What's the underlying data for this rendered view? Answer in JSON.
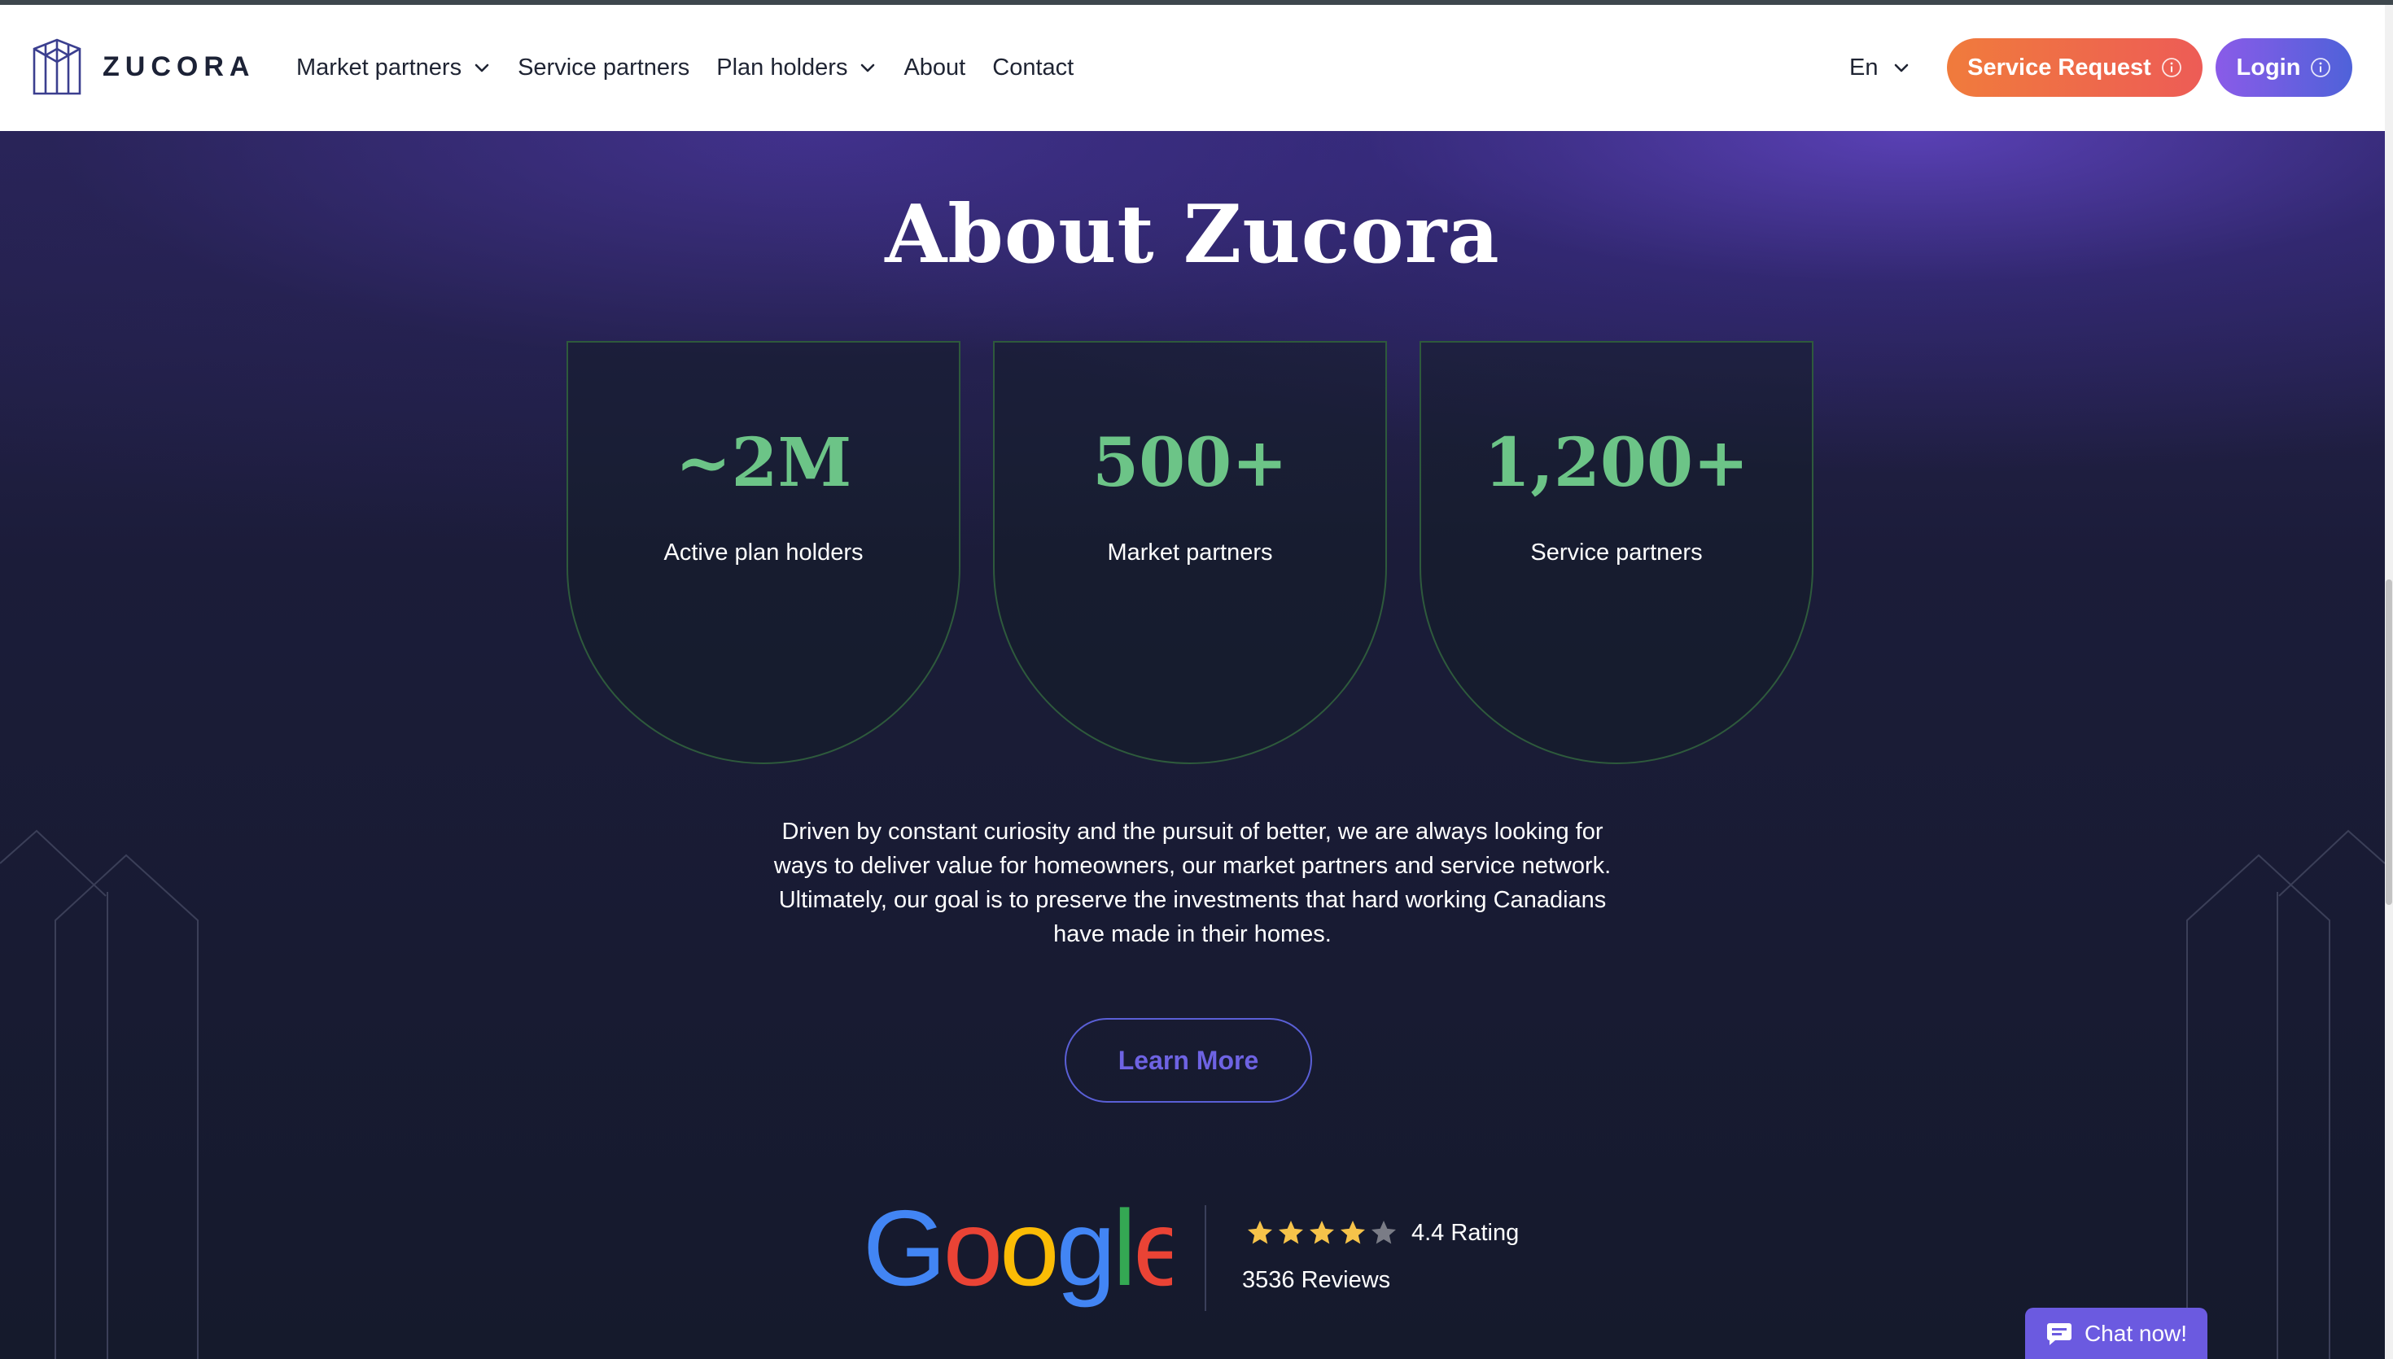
{
  "brand": {
    "name": "ZUCORA"
  },
  "nav": {
    "items": [
      {
        "label": "Market partners",
        "has_dropdown": true
      },
      {
        "label": "Service partners",
        "has_dropdown": false
      },
      {
        "label": "Plan holders",
        "has_dropdown": true
      },
      {
        "label": "About",
        "has_dropdown": false
      },
      {
        "label": "Contact",
        "has_dropdown": false
      }
    ],
    "language": "En",
    "service_request_label": "Service Request",
    "login_label": "Login"
  },
  "about": {
    "title": "About Zucora",
    "stats": [
      {
        "value": "~2M",
        "label": "Active plan holders"
      },
      {
        "value": "500+",
        "label": "Market partners"
      },
      {
        "value": "1,200+",
        "label": "Service partners"
      }
    ],
    "description": "Driven by constant curiosity and the pursuit of better, we are always looking for ways to deliver value for homeowners, our market partners and service network. Ultimately, our goal is to preserve the investments that hard working Canadians have made in their homes.",
    "cta_label": "Learn More"
  },
  "google_rating": {
    "logo_text": "Google",
    "stars_filled": 4,
    "stars_total": 5,
    "rating_label": "4.4 Rating",
    "reviews_label": "3536 Reviews"
  },
  "chat": {
    "label": "Chat now!"
  },
  "colors": {
    "accent_green": "#6cc487",
    "service_button": "#f07b3c",
    "login_button": "#6a5de2",
    "hero_bg": "#151a2c",
    "star": "#f6c34a"
  }
}
